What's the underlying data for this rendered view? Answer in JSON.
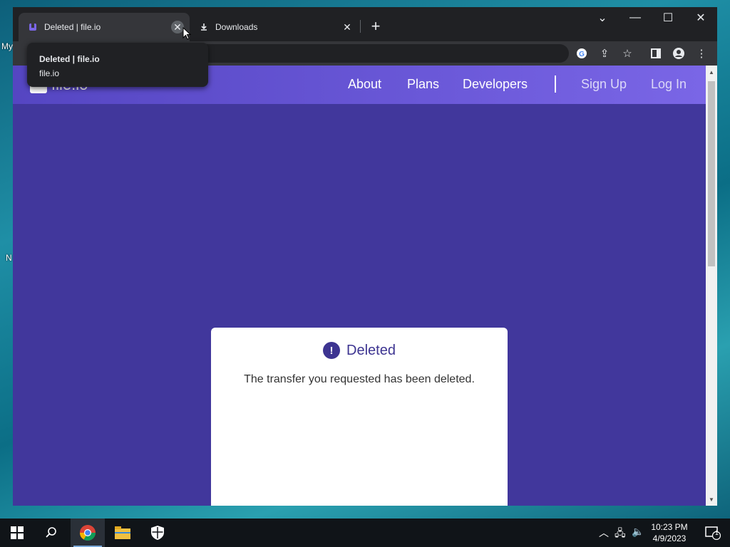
{
  "desktop": {
    "fragments": [
      "My",
      "N"
    ]
  },
  "browser": {
    "tabs": [
      {
        "title": "Deleted | file.io",
        "active": true
      },
      {
        "title": "Downloads",
        "active": false
      }
    ],
    "hover_card": {
      "title": "Deleted | file.io",
      "domain": "file.io"
    },
    "window_controls": {
      "tab_search": "⌄",
      "minimize": "—",
      "maximize": "☐",
      "close": "✕"
    }
  },
  "site": {
    "logo_text": "file.io",
    "nav": [
      "About",
      "Plans",
      "Developers"
    ],
    "auth": [
      "Sign Up",
      "Log In"
    ],
    "colors": {
      "header": "#6a58d8",
      "background": "#41379c",
      "accent": "#3d3491"
    }
  },
  "card": {
    "icon": "!",
    "title": "Deleted",
    "message": "The transfer you requested has been deleted."
  },
  "taskbar": {
    "time": "10:23 PM",
    "date": "4/9/2023",
    "notification_count": "1"
  }
}
